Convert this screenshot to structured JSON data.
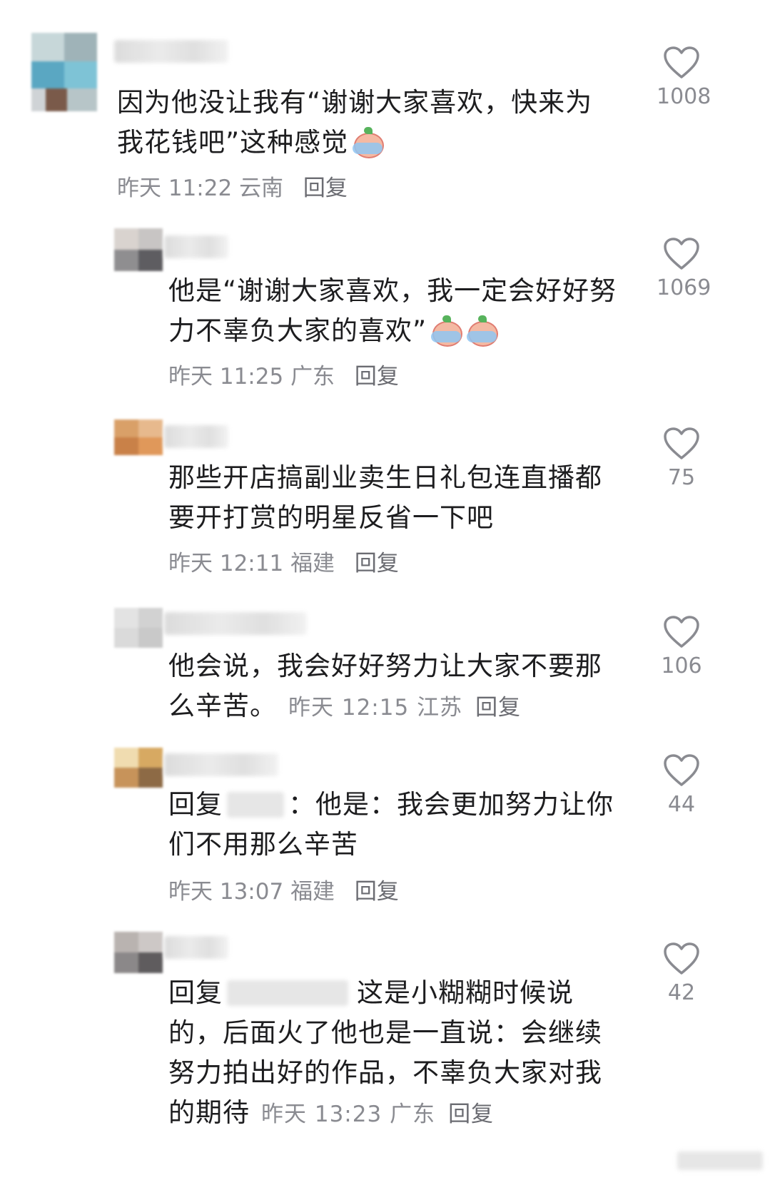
{
  "comments": [
    {
      "text": "因为他没让我有“谢谢大家喜欢，快来为我花钱吧”这种感觉",
      "time": "昨天 11:22",
      "location": "云南",
      "reply_label": "回复",
      "likes": "1008",
      "emoji": "crying-face-emoji"
    },
    {
      "text": "他是“谢谢大家喜欢，我一定会好好努力不辜负大家的喜欢”",
      "time": "昨天 11:25",
      "location": "广东",
      "reply_label": "回复",
      "likes": "1069",
      "emoji": "crying-face-emoji"
    },
    {
      "text": "那些开店搞副业卖生日礼包连直播都要开打赏的明星反省一下吧",
      "time": "昨天 12:11",
      "location": "福建",
      "reply_label": "回复",
      "likes": "75"
    },
    {
      "text": "他会说，我会好好努力让大家不要那么辛苦。",
      "time": "昨天 12:15",
      "location": "江苏",
      "reply_label": "回复",
      "likes": "106"
    },
    {
      "reply_prefix": "回复",
      "text": "：他是：我会更加努力让你们不用那么辛苦",
      "time": "昨天 13:07",
      "location": "福建",
      "reply_label": "回复",
      "likes": "44"
    },
    {
      "reply_prefix": "回复",
      "text": "这是小糊糊时候说的，后面火了他也是一直说：会继续努力拍出好的作品，不辜负大家对我的期待",
      "time": "昨天 13:23",
      "location": "广东",
      "reply_label": "回复",
      "likes": "42"
    }
  ],
  "icons": {
    "like": "heart-outline-icon"
  },
  "colors": {
    "text": "#1d1d1f",
    "meta": "#8a8b91"
  }
}
